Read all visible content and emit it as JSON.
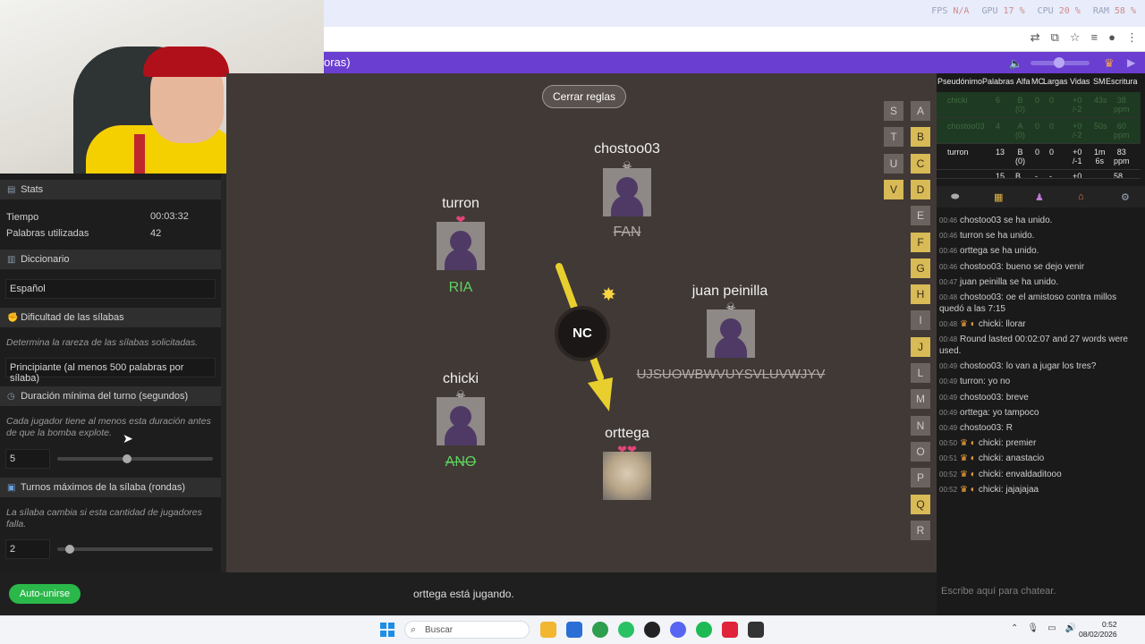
{
  "browser": {
    "perf": [
      {
        "label": "FPS",
        "value": "N/A"
      },
      {
        "label": "GPU",
        "value": "17 %"
      },
      {
        "label": "CPU",
        "value": "20 %"
      },
      {
        "label": "RAM",
        "value": "58 %"
      }
    ],
    "tab_title_fragment": "oras)"
  },
  "left": {
    "stats_header": "Stats",
    "tiempo_label": "Tiempo",
    "tiempo_value": "00:03:32",
    "palabras_label": "Palabras utilizadas",
    "palabras_value": "42",
    "dict_header": "Diccionario",
    "dict_value": "Español",
    "dif_header": "Dificultad de las sílabas",
    "dif_desc": "Determina la rareza de las sílabas solicitadas.",
    "dif_value": "Principiante (al menos 500 palabras por sílaba)",
    "dur_header": "Duración mínima del turno (segundos)",
    "dur_desc": "Cada jugador tiene al menos esta duración antes de que la bomba explote.",
    "dur_value": "5",
    "dur_slider_fraction": 0.45,
    "turn_header": "Turnos máximos de la sílaba (rondas)",
    "turn_desc": "La sílaba cambia si esta cantidad de jugadores falla.",
    "turn_value": "2",
    "turn_slider_fraction": 0.08
  },
  "bottom": {
    "auto_unirse": "Auto-unirse",
    "playing_status": "orttega está jugando."
  },
  "game": {
    "rules_button": "Cerrar reglas",
    "bomb_syllable": "NC",
    "players": {
      "chostoo03": {
        "name": "chostoo03",
        "status": "☠",
        "word": "FAN"
      },
      "turron": {
        "name": "turron",
        "status": "❤",
        "word": "RIA"
      },
      "juan": {
        "name": "juan peinilla",
        "status": "☠",
        "word": "UJSUOWBWVUYSVLUVWJYV"
      },
      "chicki": {
        "name": "chicki",
        "status": "☠",
        "word": "ANO"
      },
      "orttega": {
        "name": "orttega",
        "status": "❤❤"
      }
    },
    "letters_col1": [
      "S",
      "T",
      "U",
      "V"
    ],
    "letters_col2": [
      "A",
      "B",
      "C",
      "D",
      "E",
      "F",
      "G",
      "H",
      "I",
      "J",
      "L",
      "M",
      "N",
      "O",
      "P",
      "Q",
      "R"
    ],
    "letters_on": [
      "V",
      "B",
      "C",
      "D",
      "F",
      "G",
      "H",
      "J",
      "Q"
    ]
  },
  "scoreboard": {
    "headers": [
      "Pseudónimo",
      "Palabras",
      "Alfa",
      "MC",
      "Largas",
      "Vidas",
      "SM",
      "Escritura"
    ],
    "rows": [
      {
        "name": "chicki",
        "words": "6",
        "alfa": "B\n(0)",
        "mc": "0",
        "largas": "0",
        "vidas": "+0\n/-2",
        "sm": "43s",
        "esc": "38\nppm"
      },
      {
        "name": "chostoo03",
        "words": "4",
        "alfa": "A\n(0)",
        "mc": "0",
        "largas": "0",
        "vidas": "+0\n/-2",
        "sm": "50s",
        "esc": "60\nppm"
      },
      {
        "name": "turron",
        "words": "13",
        "alfa": "B\n(0)",
        "mc": "0",
        "largas": "0",
        "vidas": "+0\n/-1",
        "sm": "1m\n6s",
        "esc": "83\nppm"
      },
      {
        "name": "...",
        "words": "15",
        "alfa": "B",
        "mc": "-",
        "largas": "-",
        "vidas": "+0",
        "sm": "",
        "esc": "58"
      }
    ]
  },
  "chat": {
    "messages": [
      {
        "time": "00:46",
        "text": "chostoo03 se ha unido.",
        "crown": false
      },
      {
        "time": "00:46",
        "text": "turron se ha unido.",
        "crown": false
      },
      {
        "time": "00:46",
        "text": "orttega se ha unido.",
        "crown": false
      },
      {
        "time": "00:46",
        "text": "chostoo03: bueno se dejo venir",
        "crown": false
      },
      {
        "time": "00:47",
        "text": "juan peinilla se ha unido.",
        "crown": false
      },
      {
        "time": "00:48",
        "text": "chostoo03: oe el amistoso contra millos quedó a las 7:15",
        "crown": false
      },
      {
        "time": "00:48",
        "text": "chicki: llorar",
        "crown": true
      },
      {
        "time": "00:48",
        "text": "Round lasted 00:02:07 and 27 words were used.",
        "crown": false
      },
      {
        "time": "00:49",
        "text": "chostoo03: lo van a jugar los tres?",
        "crown": false
      },
      {
        "time": "00:49",
        "text": "turron: yo no",
        "crown": false
      },
      {
        "time": "00:49",
        "text": "chostoo03: breve",
        "crown": false
      },
      {
        "time": "00:49",
        "text": "orttega: yo tampoco",
        "crown": false
      },
      {
        "time": "00:49",
        "text": "chostoo03: R",
        "crown": false
      },
      {
        "time": "00:50",
        "text": "chicki: premier",
        "crown": true
      },
      {
        "time": "00:51",
        "text": "chicki: anastacio",
        "crown": true
      },
      {
        "time": "00:52",
        "text": "chicki: envaldaditooo",
        "crown": true
      },
      {
        "time": "00:52",
        "text": "chicki: jajajajaa",
        "crown": true
      }
    ],
    "placeholder": "Escribe aquí para chatear."
  },
  "taskbar": {
    "search_placeholder": "Buscar",
    "time": "0:52",
    "date": "08/02/2026"
  }
}
